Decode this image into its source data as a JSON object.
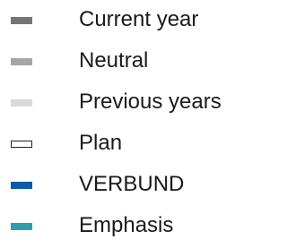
{
  "legend": {
    "items": [
      {
        "label": "Current year",
        "swatch_color": "#757575",
        "swatch_style": "filled"
      },
      {
        "label": "Neutral",
        "swatch_color": "#a6a6a6",
        "swatch_style": "filled"
      },
      {
        "label": "Previous years",
        "swatch_color": "#d9d9d9",
        "swatch_style": "filled"
      },
      {
        "label": "Plan",
        "swatch_color": "#ffffff",
        "swatch_style": "outline"
      },
      {
        "label": "VERBUND",
        "swatch_color": "#0d5aa6",
        "swatch_style": "filled"
      },
      {
        "label": "Emphasis",
        "swatch_color": "#2a9fae",
        "swatch_style": "filled"
      }
    ]
  }
}
